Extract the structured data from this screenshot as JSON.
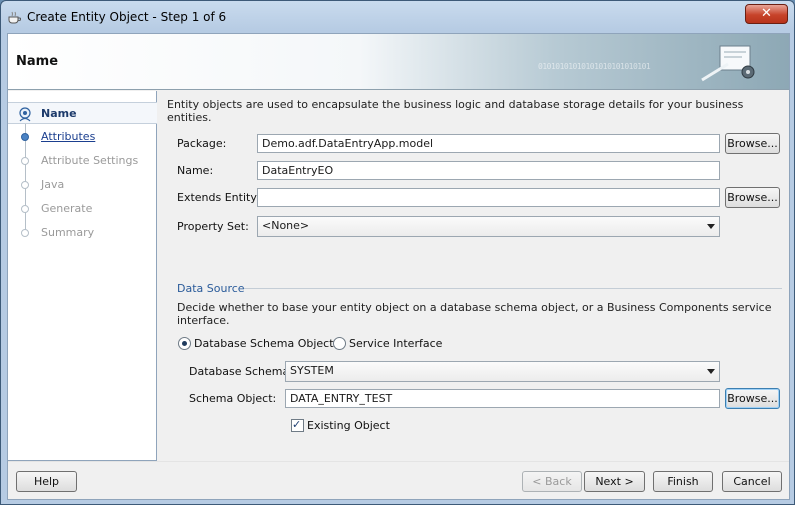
{
  "window": {
    "title": "Create Entity Object - Step 1 of 6",
    "close_glyph": "✕"
  },
  "banner": {
    "title": "Name",
    "binary": "01010101010101010101010101"
  },
  "nav": {
    "items": [
      {
        "label": "Name",
        "state": "active"
      },
      {
        "label": "Attributes",
        "state": "link"
      },
      {
        "label": "Attribute Settings",
        "state": "disabled"
      },
      {
        "label": "Java",
        "state": "disabled"
      },
      {
        "label": "Generate",
        "state": "disabled"
      },
      {
        "label": "Summary",
        "state": "disabled"
      }
    ]
  },
  "intro": "Entity objects are used to encapsulate the business logic and database storage details for your business entities.",
  "form": {
    "package_label": "Package:",
    "package_value": "Demo.adf.DataEntryApp.model",
    "name_label": "Name:",
    "name_value": "DataEntryEO",
    "extends_label": "Extends Entity:",
    "extends_value": "",
    "property_set_label": "Property Set:",
    "property_set_value": "<None>",
    "browse_label": "Browse..."
  },
  "data_source": {
    "title": "Data Source",
    "description": "Decide whether to base your entity object on a database schema object, or a Business Components service interface.",
    "radio_db": "Database Schema Object",
    "radio_db_selected": true,
    "radio_service": "Service Interface",
    "radio_service_selected": false,
    "schema_label": "Database Schema:",
    "schema_value": "SYSTEM",
    "schema_object_label": "Schema Object:",
    "schema_object_value": "DATA_ENTRY_TEST",
    "existing_label": "Existing Object",
    "existing_checked": true
  },
  "footer": {
    "help": "Help",
    "back": "< Back",
    "next": "Next >",
    "finish": "Finish",
    "cancel": "Cancel"
  },
  "colors": {
    "accent": "#2a5b9a",
    "close": "#c7432a",
    "link": "#1b3f8f"
  }
}
